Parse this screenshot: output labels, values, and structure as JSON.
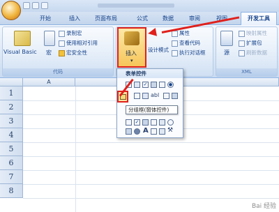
{
  "tabs": [
    "开始",
    "插入",
    "页面布局",
    "公式",
    "数据",
    "审阅",
    "视图"
  ],
  "active_tab": "开发工具",
  "groups": {
    "code": {
      "label": "代码",
      "visual_basic": "Visual Basic",
      "macro": "宏",
      "record_macro": "录制宏",
      "relative_ref": "使用相对引用",
      "macro_security": "宏安全性"
    },
    "controls": {
      "insert": "插入",
      "design_mode": "设计模式",
      "properties": "属性",
      "view_code": "查看代码",
      "run_dialog": "执行对话框"
    },
    "xml": {
      "label": "XML",
      "source": "源",
      "map_props": "映射属性",
      "expansion": "扩展包",
      "refresh": "刷新数据"
    }
  },
  "dropdown": {
    "header": "表单控件",
    "tooltip": "分组框(窗体控件)"
  },
  "sheet": {
    "col_headers": [
      "A",
      "B"
    ],
    "row_headers": [
      "1",
      "2",
      "3",
      "4",
      "5",
      "6",
      "7",
      "8"
    ]
  },
  "watermark": "Bai 经验",
  "colors": {
    "highlight": "#e0201c",
    "ribbon": "#dbe7f6"
  }
}
